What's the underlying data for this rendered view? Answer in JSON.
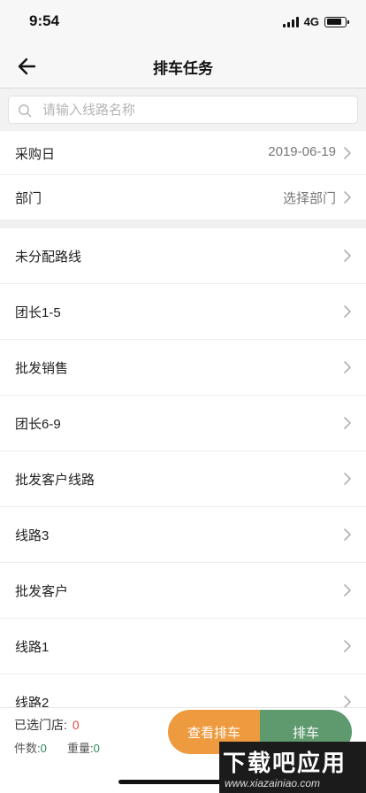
{
  "status_bar": {
    "time": "9:54",
    "network": "4G"
  },
  "nav": {
    "title": "排车任务"
  },
  "search": {
    "placeholder": "请输入线路名称",
    "value": ""
  },
  "filters": {
    "purchase_day": {
      "label": "采购日",
      "value": "2019-06-19"
    },
    "department": {
      "label": "部门",
      "value": "选择部门"
    }
  },
  "routes": [
    {
      "label": "未分配路线"
    },
    {
      "label": "团长1-5"
    },
    {
      "label": "批发销售"
    },
    {
      "label": "团长6-9"
    },
    {
      "label": "批发客户线路"
    },
    {
      "label": "线路3"
    },
    {
      "label": "批发客户"
    },
    {
      "label": "线路1"
    },
    {
      "label": "线路2"
    }
  ],
  "footer": {
    "stores_label": "已选门店:",
    "stores_value": "0",
    "pieces_label": "件数:",
    "pieces_value": "0",
    "weight_label": "重量:",
    "weight_value": "0",
    "view_button": "查看排车",
    "dispatch_button": "排车"
  },
  "watermark": {
    "main": "下载吧应用",
    "sub": "www.xiazainiao.com"
  },
  "colors": {
    "accent_orange": "#ee9a3e",
    "accent_green": "#5e9a6e",
    "count_red": "#e24a3b"
  },
  "icons": [
    "back-arrow-icon",
    "search-icon",
    "chevron-right-icon",
    "signal-icon",
    "battery-icon"
  ]
}
